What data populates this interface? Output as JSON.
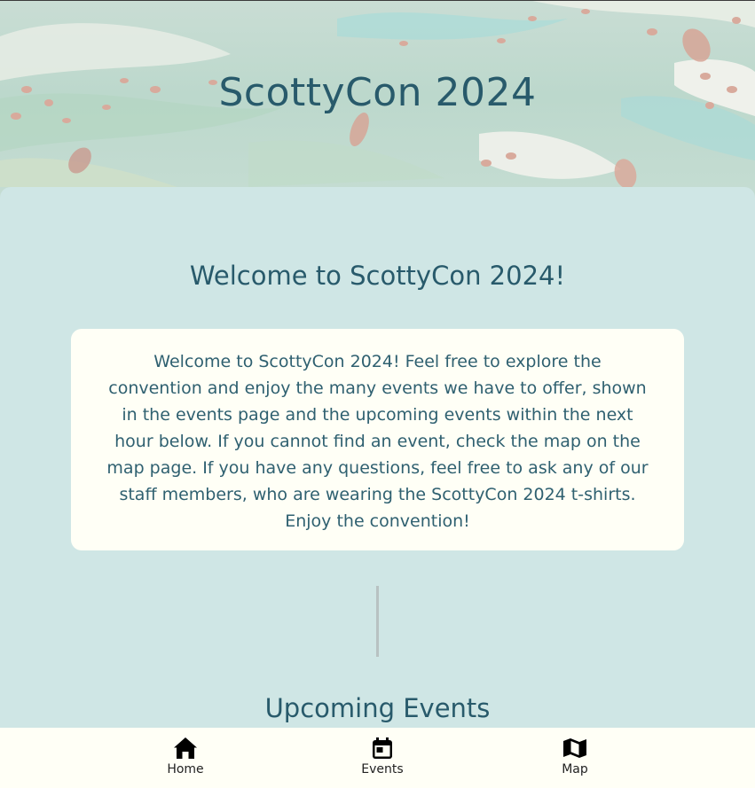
{
  "hero": {
    "title": "ScottyCon 2024"
  },
  "welcome": {
    "heading": "Welcome to ScottyCon 2024!",
    "body": "Welcome to ScottyCon 2024! Feel free to explore the convention and enjoy the many events we have to offer, shown in the events page and the upcoming events within the next hour below. If you cannot find an event, check the map on the map page. If you have any questions, feel free to ask any of our staff members, who are wearing the ScottyCon 2024 t-shirts. Enjoy the convention!"
  },
  "upcoming": {
    "heading": "Upcoming Events"
  },
  "nav": {
    "items": [
      {
        "label": "Home",
        "icon": "home-icon"
      },
      {
        "label": "Events",
        "icon": "calendar-icon"
      },
      {
        "label": "Map",
        "icon": "map-icon"
      }
    ]
  },
  "colors": {
    "heading": "#285a6b",
    "background": "#cfe6e5",
    "card": "#fffff6"
  }
}
